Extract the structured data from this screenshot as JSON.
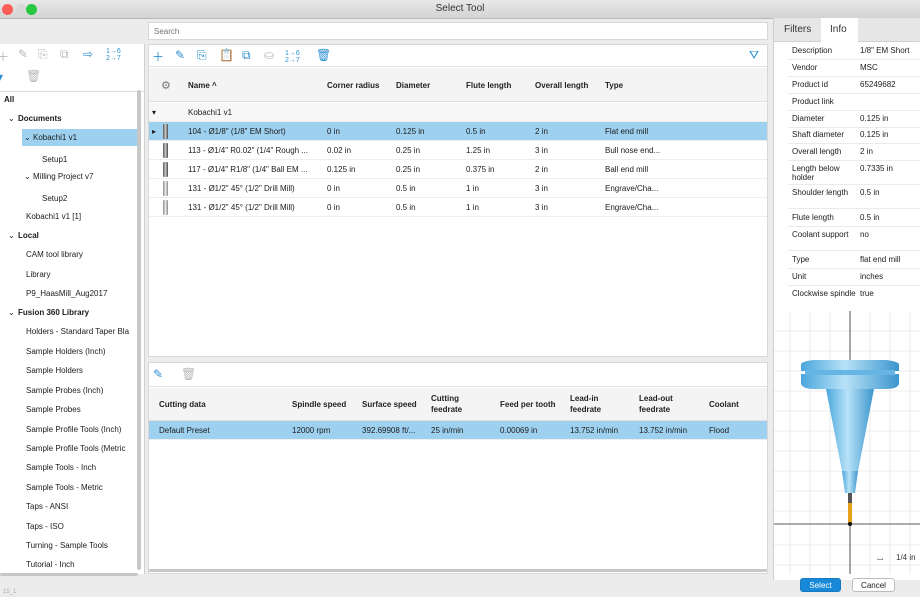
{
  "window": {
    "title": "Select Tool"
  },
  "search": {
    "placeholder": "Search"
  },
  "tree": {
    "all": "All",
    "documents": "Documents",
    "kobachi": "Kobachi1 v1",
    "setup1": "Setup1",
    "milling": "Milling Project v7",
    "setup2": "Setup2",
    "kobachi1": "Kobachi1 v1 [1]",
    "local": "Local",
    "cam": "CAM tool library",
    "library": "Library",
    "p9": "P9_HaasMill_Aug2017",
    "fusion": "Fusion 360 Library",
    "libraries": [
      "Holders - Standard Taper Bla",
      "Sample Holders (Inch)",
      "Sample Holders",
      "Sample Probes (Inch)",
      "Sample Probes",
      "Sample Profile Tools (Inch)",
      "Sample Profile Tools (Metric",
      "Sample Tools - Inch",
      "Sample Tools - Metric",
      "Taps - ANSI",
      "Taps - ISO",
      "Turning - Sample Tools",
      "Tutorial - Inch"
    ]
  },
  "tools_table": {
    "headers": [
      "Name ^",
      "Corner radius",
      "Diameter",
      "Flute length",
      "Overall length",
      "Type"
    ],
    "group": "Kobachi1 v1",
    "rows": [
      [
        "104 - Ø1/8\" (1/8\" EM Short)",
        "0 in",
        "0.125 in",
        "0.5 in",
        "2 in",
        "Flat end mill"
      ],
      [
        "113 - Ø1/4\" R0.02\" (1/4\" Rough ...",
        "0.02 in",
        "0.25 in",
        "1.25 in",
        "3 in",
        "Bull nose end..."
      ],
      [
        "117 - Ø1/4\" R1/8\" (1/4\" Ball EM ...",
        "0.125 in",
        "0.25 in",
        "0.375 in",
        "2 in",
        "Ball end mill"
      ],
      [
        "131 - Ø1/2\" 45° (1/2\" Drill Mill)",
        "0 in",
        "0.5 in",
        "1 in",
        "3 in",
        "Engrave/Cha..."
      ],
      [
        "131 - Ø1/2\" 45° (1/2\" Drill Mill)",
        "0 in",
        "0.5 in",
        "1 in",
        "3 in",
        "Engrave/Cha..."
      ]
    ]
  },
  "cutting_table": {
    "headers": [
      "Cutting data",
      "Spindle speed",
      "Surface speed",
      "Cutting feedrate",
      "Feed per tooth",
      "Lead-in feedrate",
      "Lead-out feedrate",
      "Coolant"
    ],
    "row": [
      "Default Preset",
      "12000 rpm",
      "392.69908 ft/...",
      "25 in/min",
      "0.00069 in",
      "13.752 in/min",
      "13.752 in/min",
      "Flood"
    ]
  },
  "right": {
    "tabs": [
      "Filters",
      "Info"
    ],
    "props": [
      [
        "Description",
        "1/8\" EM Short"
      ],
      [
        "Vendor",
        "MSC"
      ],
      [
        "Product id",
        "65249682"
      ],
      [
        "Product link",
        ""
      ],
      [
        "Diameter",
        "0.125 in"
      ],
      [
        "Shaft diameter",
        "0.125 in"
      ],
      [
        "Overall length",
        "2 in"
      ],
      [
        "Length below holder",
        "0.7335 in"
      ],
      [
        "Shoulder length",
        "0.5 in"
      ],
      [
        "Flute length",
        "0.5 in"
      ],
      [
        "Coolant support",
        "no"
      ],
      [
        "Type",
        "flat end mill"
      ],
      [
        "Unit",
        "inches"
      ],
      [
        "Clockwise spindle",
        "true"
      ]
    ],
    "scale": "1/4 in"
  },
  "buttons": {
    "select": "Select",
    "cancel": "Cancel"
  },
  "footer": "15_1",
  "colors": {
    "accent": "#2b8fd0",
    "selection": "#9ed0ef",
    "tool_body": "#7cc6ee",
    "flute": "#e6a21a"
  }
}
